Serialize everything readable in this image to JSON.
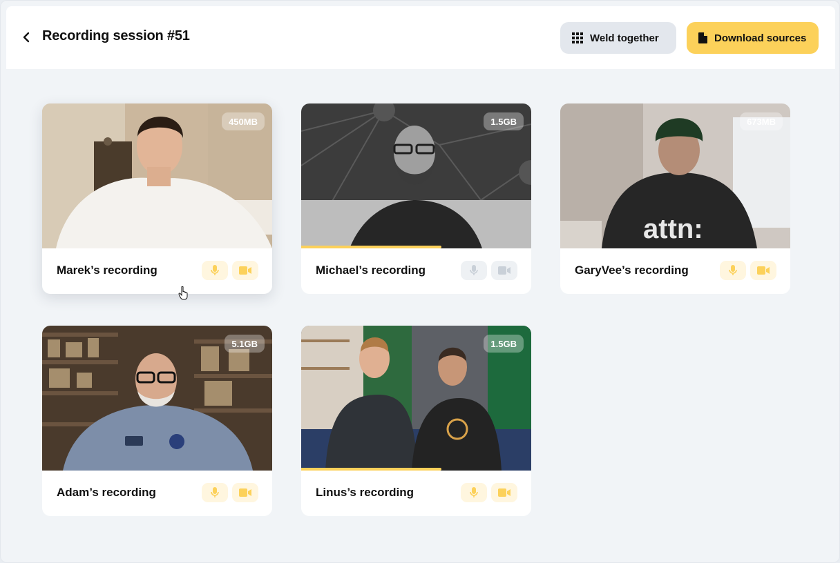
{
  "header": {
    "title": "Recording session #51",
    "weld_label": "Weld together",
    "download_label": "Download sources"
  },
  "colors": {
    "accent": "#fcd15a",
    "accent_bg": "#fff6df",
    "muted_icon": "#c9d0d8",
    "muted_bg": "#eef1f4",
    "page_bg": "#f1f4f7"
  },
  "recordings": [
    {
      "name": "Marek’s recording",
      "size": "450MB",
      "mic": "on",
      "camera": "on",
      "progress": 0
    },
    {
      "name": "Michael’s recording",
      "size": "1.5GB",
      "mic": "off",
      "camera": "off",
      "progress": 0.61
    },
    {
      "name": "GaryVee’s recording",
      "size": "673MB",
      "mic": "on",
      "camera": "on",
      "progress": 0
    },
    {
      "name": "Adam’s recording",
      "size": "5.1GB",
      "mic": "on",
      "camera": "on",
      "progress": 0
    },
    {
      "name": "Linus’s recording",
      "size": "1.5GB",
      "mic": "on",
      "camera": "on",
      "progress": 0.61
    }
  ],
  "icons": {
    "back": "chevron-left-icon",
    "weld": "grid-icon",
    "download": "document-icon",
    "mic": "microphone-icon",
    "camera": "video-camera-icon",
    "cursor": "hand-pointer-icon"
  }
}
